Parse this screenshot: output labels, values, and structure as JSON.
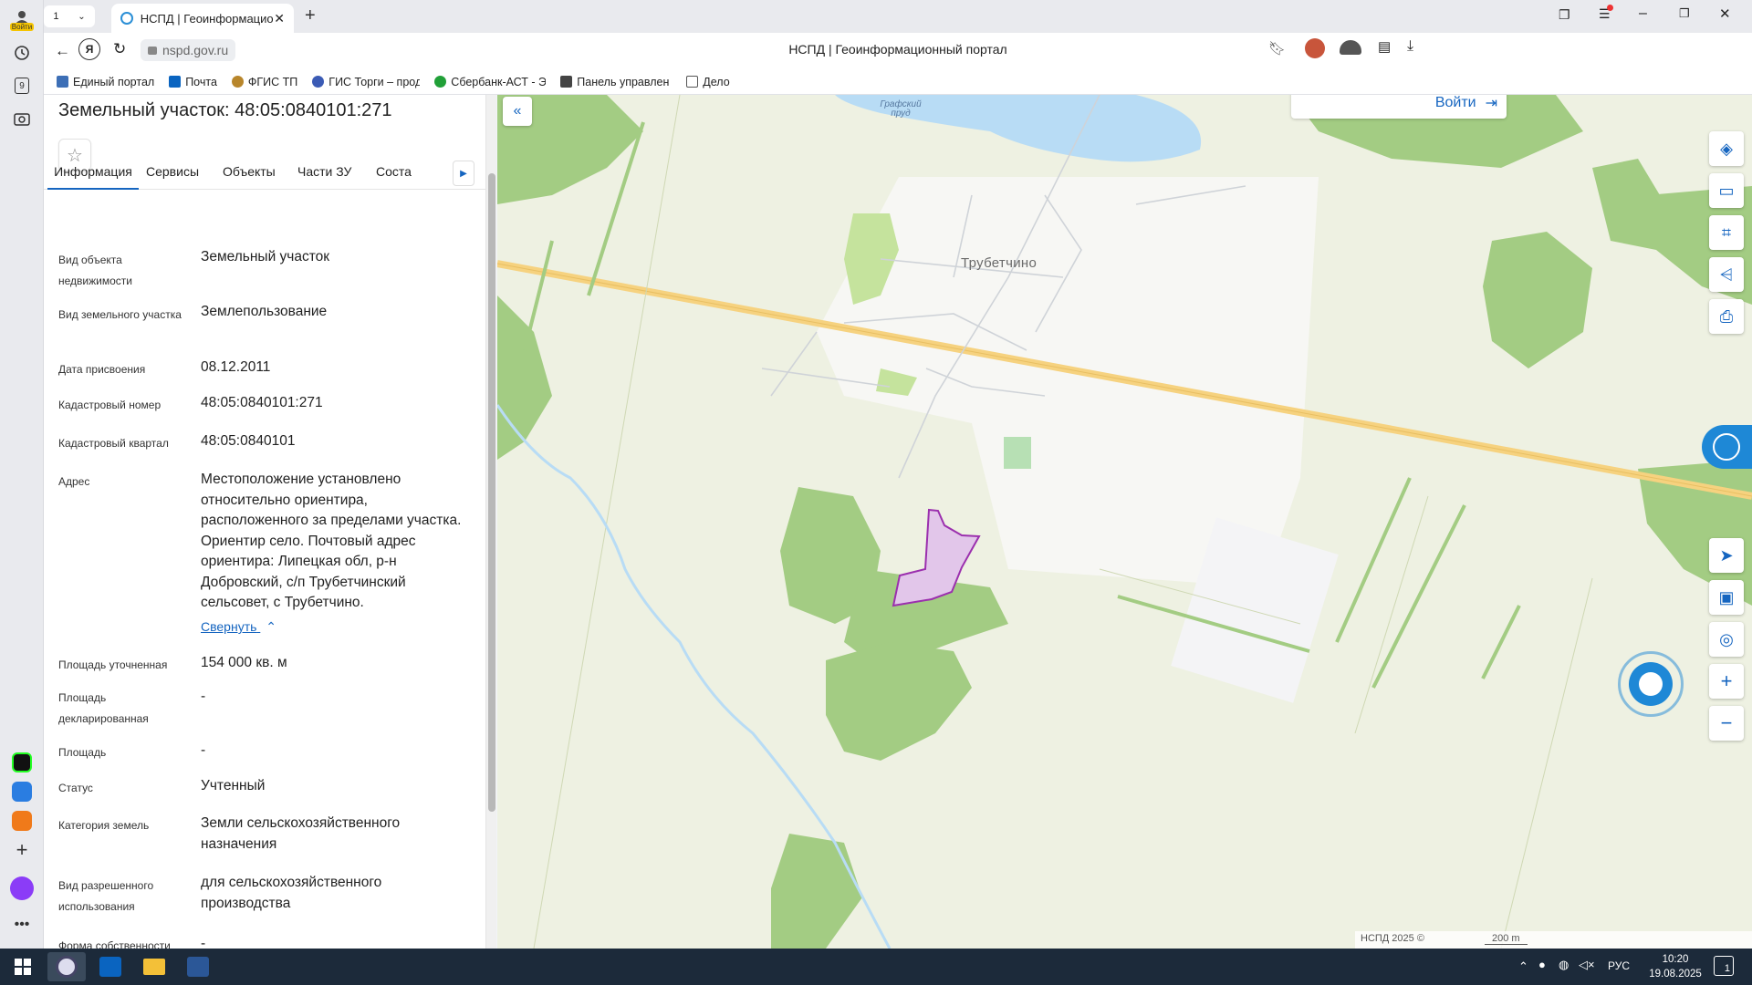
{
  "browser": {
    "profile_label": "Войти",
    "tab_counter": "1",
    "tab_title": "НСПД | Геоинформационный портал",
    "page_title": "НСПД | Геоинформационный портал",
    "url": "nspd.gov.ru",
    "rail_badge": "9",
    "bookmarks": [
      {
        "label": "Единый портал",
        "icon": "gosuslugi-icon",
        "color": "#3d6fb6"
      },
      {
        "label": "Почта",
        "icon": "outlook-icon",
        "color": "#0a64c0"
      },
      {
        "label": "ФГИС ТП",
        "icon": "emblem-icon",
        "color": "#b8862b"
      },
      {
        "label": "ГИС Торги – прод",
        "icon": "eagle-icon",
        "color": "#3b5bb5"
      },
      {
        "label": "Сбербанк-АСТ - Э",
        "icon": "sber-icon",
        "color": "#21a038"
      },
      {
        "label": "Панель управлен",
        "icon": "fin-icon",
        "color": "#444444"
      },
      {
        "label": "Дело",
        "icon": "document-icon",
        "color": "#555555"
      }
    ]
  },
  "panel": {
    "title": "Земельный участок: 48:05:0840101:271",
    "tabs": [
      "Информация",
      "Сервисы",
      "Объекты",
      "Части ЗУ",
      "Соста"
    ],
    "active_tab_index": 0,
    "properties": [
      {
        "label": "Вид объекта недвижимости",
        "value": "Земельный участок"
      },
      {
        "label": "Вид земельного участка",
        "value": "Землепользование"
      },
      {
        "label": "Дата присвоения",
        "value": "08.12.2011"
      },
      {
        "label": "Кадастровый номер",
        "value": "48:05:0840101:271"
      },
      {
        "label": "Кадастровый квартал",
        "value": "48:05:0840101"
      },
      {
        "label": "Адрес",
        "value": "Местоположение установлено относительно ориентира, расположенного за пределами участка. Ориентир село. Почтовый адрес ориентира: Липецкая обл, р-н Добровский, с/п Трубетчинский сельсовет, с Трубетчино."
      },
      {
        "label": "Площадь уточненная",
        "value": "154 000 кв. м"
      },
      {
        "label": "Площадь декларированная",
        "value": "-"
      },
      {
        "label": "Площадь",
        "value": "-"
      },
      {
        "label": "Статус",
        "value": "Учтенный"
      },
      {
        "label": "Категория земель",
        "value": "Земли сельскохозяйственного назначения"
      },
      {
        "label": "Вид разрешенного использования",
        "value": "для сельскохозяйственного производства"
      },
      {
        "label": "Форма собственности",
        "value": "-"
      }
    ],
    "collapse_link": "Свернуть"
  },
  "map": {
    "login_label": "Войти",
    "pond_label": "Графский пруд",
    "village_label": "Трубетчино",
    "attribution": "НСПД 2025 ©",
    "scale_label": "200 m",
    "colors": {
      "forest": "#a3cc83",
      "field": "#eef1e2",
      "road": "#f6d27f",
      "water": "#b8dcf5",
      "parcel": "#9b2fae",
      "accent": "#1565c0"
    }
  },
  "taskbar": {
    "language": "РУС",
    "time": "10:20",
    "date": "19.08.2025",
    "notification_count": "1"
  }
}
